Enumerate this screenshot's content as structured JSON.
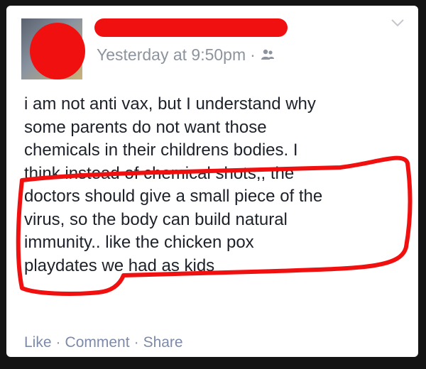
{
  "post": {
    "timestamp": "Yesterday at 9:50pm",
    "separator": "·",
    "audience_icon": "friends-icon",
    "text": "i am not anti vax, but I understand why\nsome parents do not want those\nchemicals in their childrens bodies. I\nthink instead of chemical shots,, the\ndoctors should give a small piece of the\nvirus, so the body can build natural\nimmunity.. like the chicken pox\nplaydates we had as kids"
  },
  "actions": {
    "like": "Like",
    "comment": "Comment",
    "share": "Share",
    "dot": "·"
  },
  "colors": {
    "redaction": "#f01010",
    "meta_text": "#8d949e",
    "action_link": "#7d8aa8",
    "body_text": "#1d2129"
  }
}
